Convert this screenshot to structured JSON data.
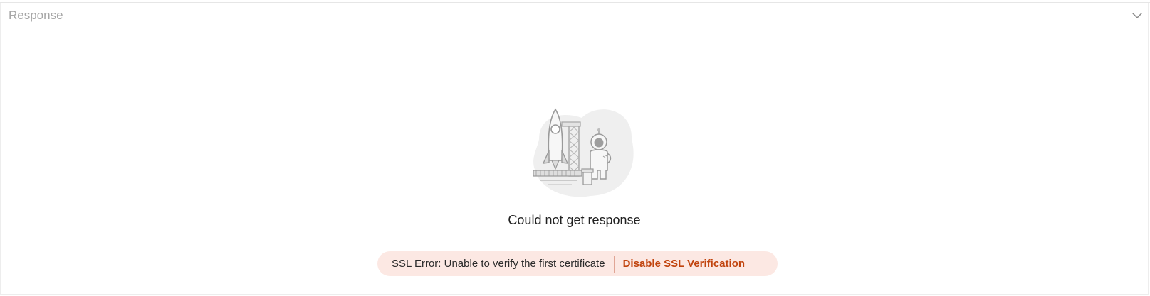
{
  "panel": {
    "title": "Response",
    "collapse_icon": "chevron-down-icon"
  },
  "empty_state": {
    "illustration": "rocket-launch-astronaut-illustration",
    "headline": "Could not get response"
  },
  "error": {
    "message": "SSL Error: Unable to verify the first certificate",
    "action_label": "Disable SSL Verification"
  },
  "colors": {
    "panel_title": "#a6a6a6",
    "headline": "#212121",
    "error_bg": "#fce8e3",
    "action": "#c1440e"
  }
}
